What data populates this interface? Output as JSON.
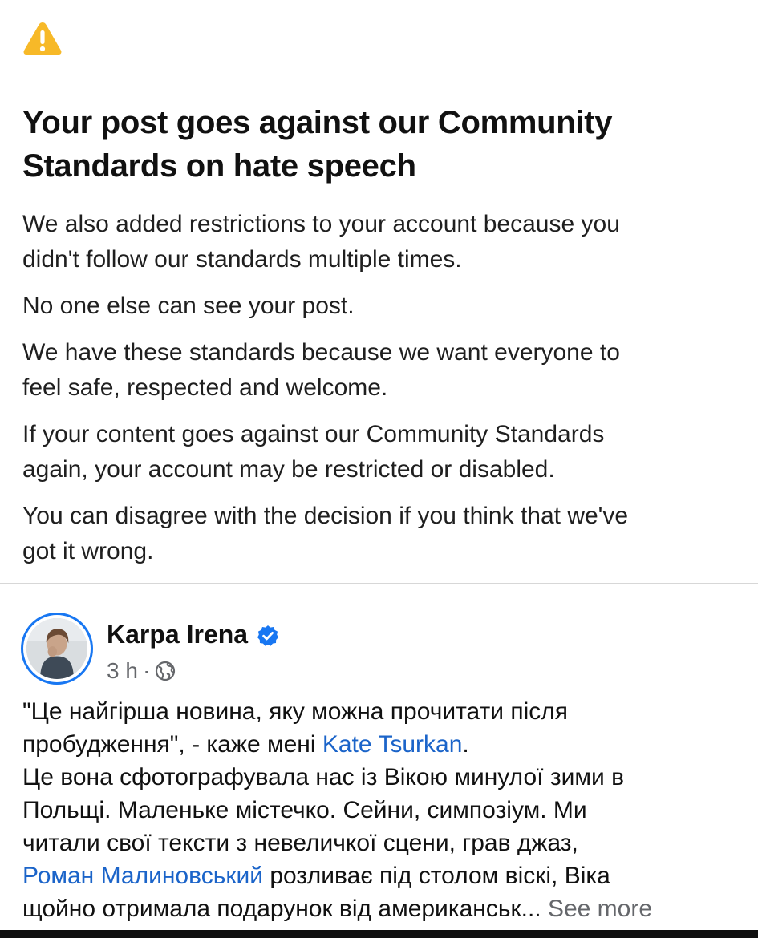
{
  "icons": {
    "warning": "warning-triangle-icon",
    "verified": "verified-badge-icon",
    "audience": "globe-icon"
  },
  "colors": {
    "warning": "#f7b928",
    "link": "#1b64c9",
    "verified": "#1877f2",
    "secondary_text": "#65676b"
  },
  "notice": {
    "title_line1": "Your post goes against our Community",
    "title_line2": "Standards on hate speech",
    "paragraphs": [
      {
        "line1": "We also added restrictions to your account because you",
        "line2": "didn't follow our standards multiple times."
      },
      {
        "line1": "No one else can see your post."
      },
      {
        "line1": "We have these standards because we want everyone to",
        "line2": "feel safe, respected and welcome."
      },
      {
        "line1": "If your content goes against our Community Standards",
        "line2": "again, your account may be restricted or disabled."
      },
      {
        "line1": "You can disagree with the decision if you think that we've",
        "line2": "got it wrong."
      }
    ]
  },
  "post": {
    "author": "Karpa Irena",
    "time": "3 h",
    "separator": "·",
    "lines": {
      "l1": "\"Це найгірша новина, яку можна прочитати після",
      "l2_text": "пробудження\", - каже мені ",
      "l2_link": "Kate Tsurkan",
      "l2_end": ".",
      "l3": "Це вона сфотографувала нас із Вікою минулої зими в",
      "l4": "Польщі. Маленьке містечко. Сейни, симпозіум.  Ми",
      "l5": "читали свої тексти з невеличкої сцени, грав джаз,",
      "l6_link": "Роман Малиновський",
      "l6_text": " розливає під столом віскі, Віка",
      "l7_text": "щойно отримала подарунок від американськ... ",
      "see_more": "See more"
    }
  }
}
